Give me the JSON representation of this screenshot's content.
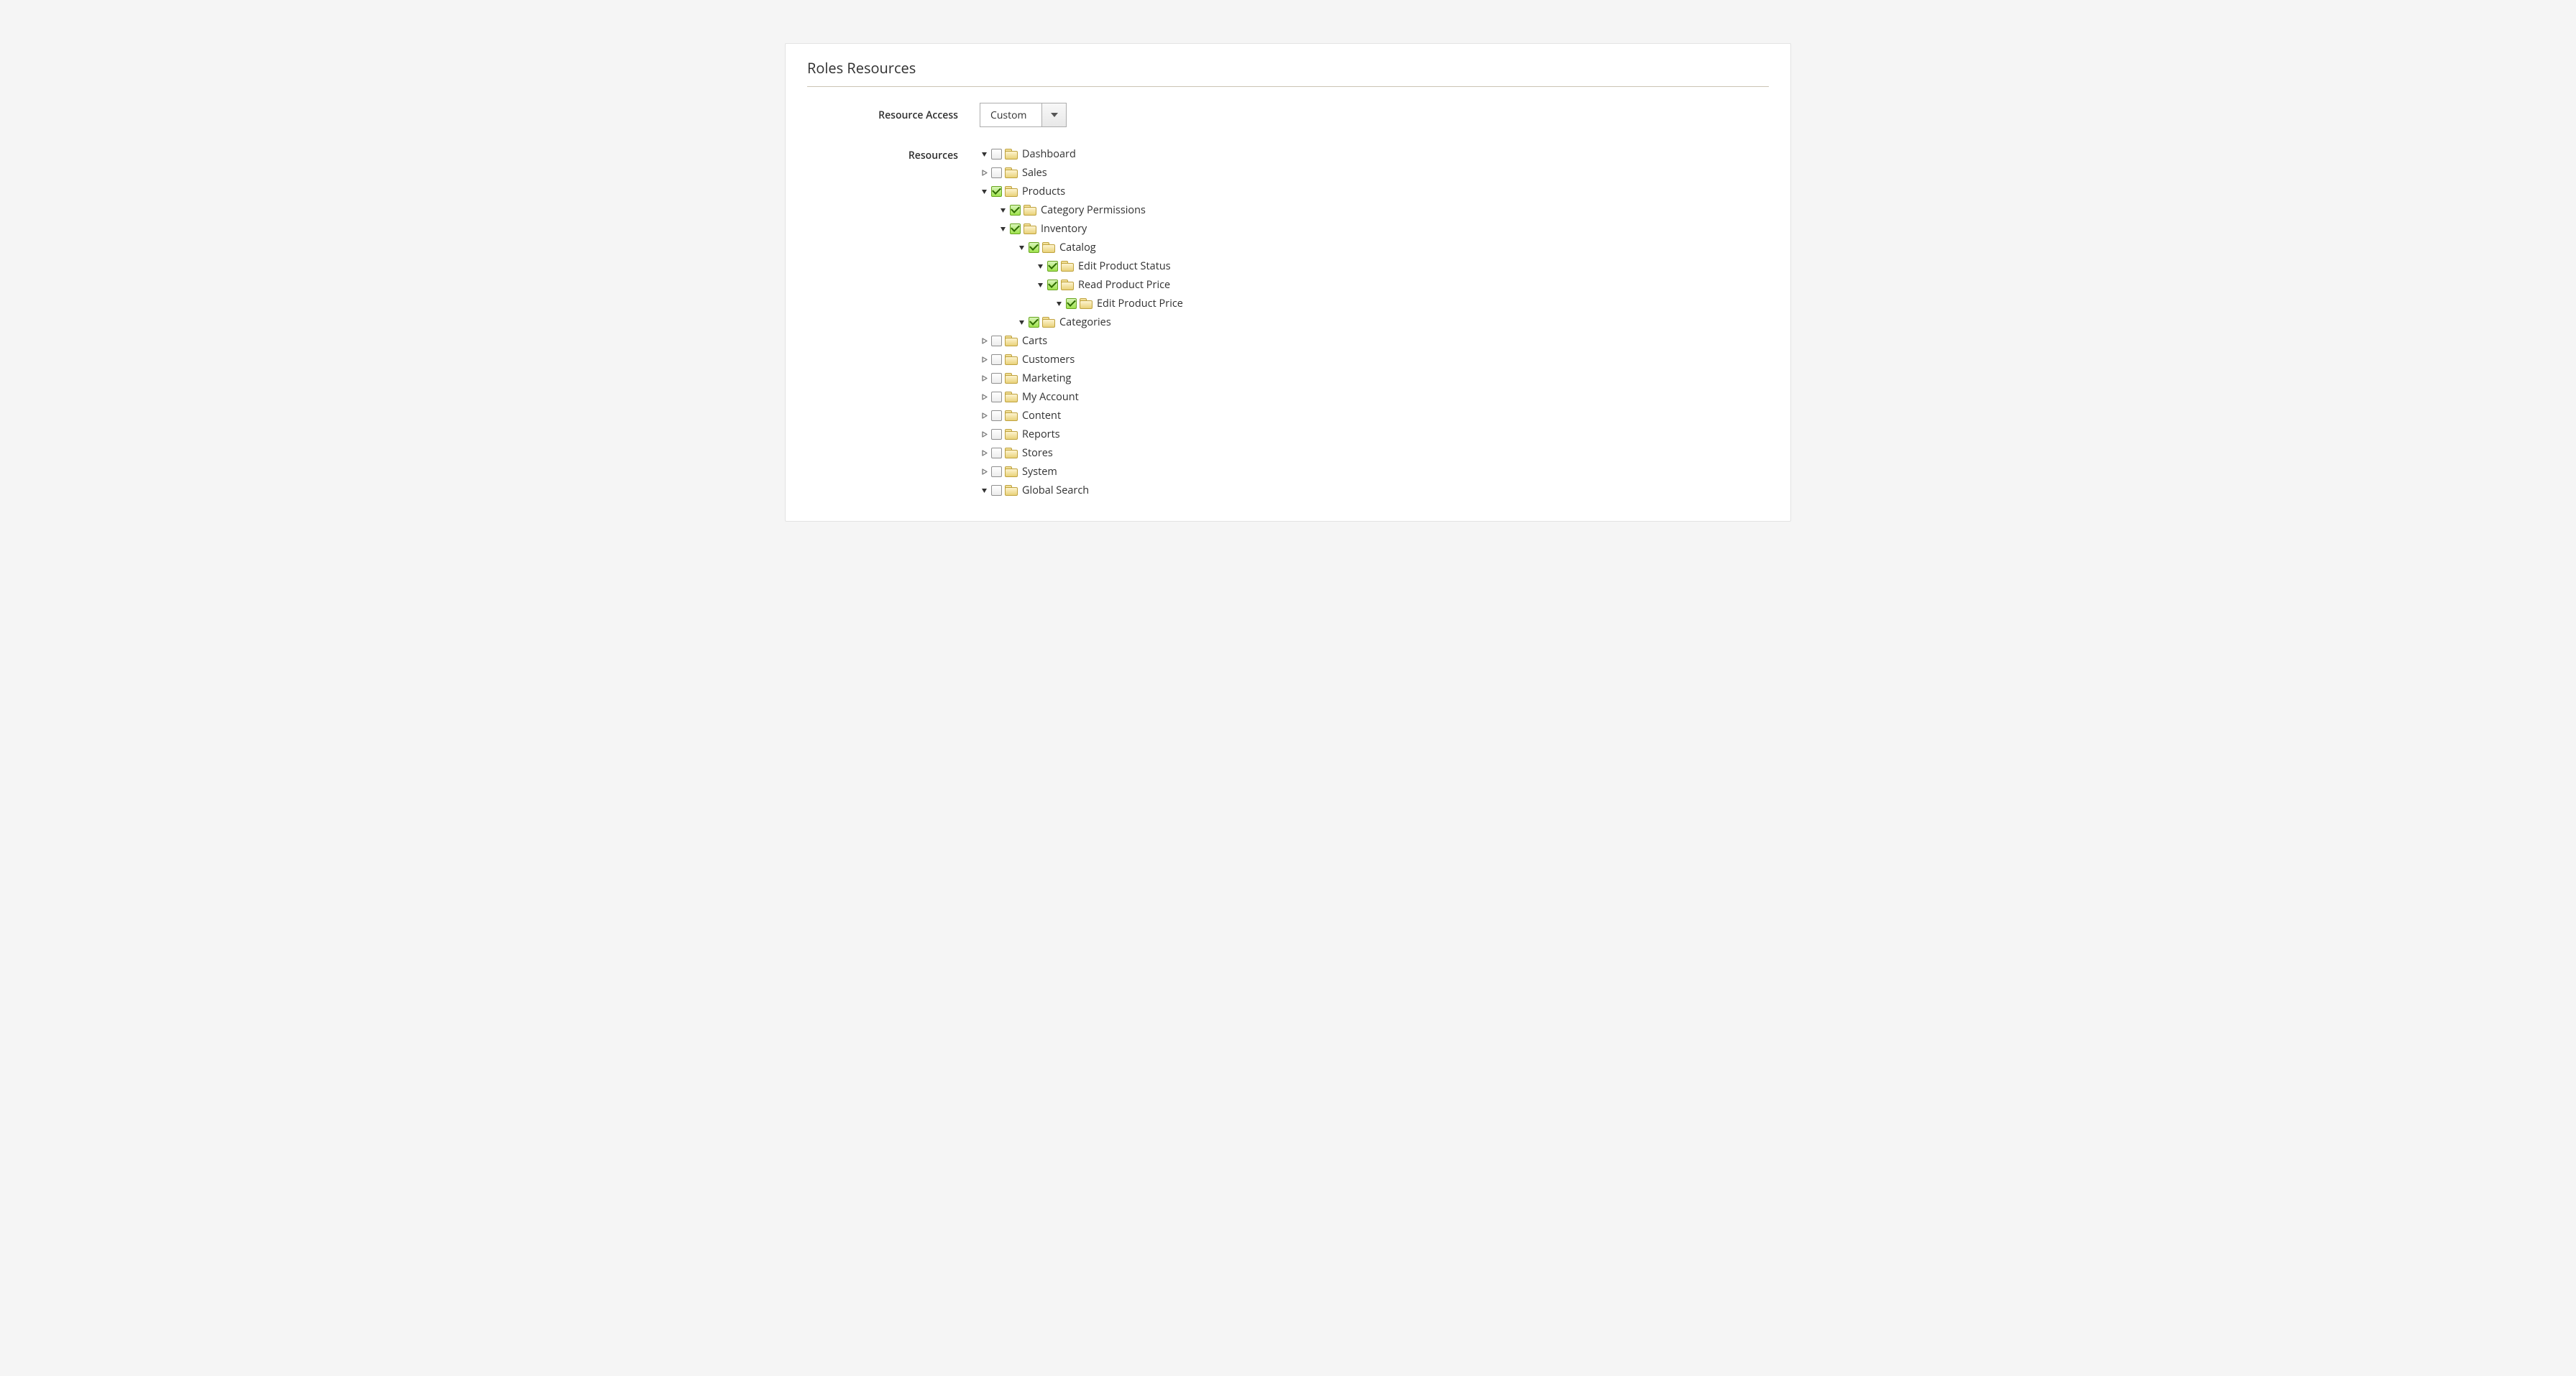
{
  "panel": {
    "title": "Roles Resources"
  },
  "labels": {
    "resource_access": "Resource Access",
    "resources": "Resources"
  },
  "select": {
    "value": "Custom"
  },
  "tree": [
    {
      "label": "Dashboard",
      "checked": false,
      "expanded": true,
      "hasChildren": false
    },
    {
      "label": "Sales",
      "checked": false,
      "expanded": false,
      "hasChildren": true
    },
    {
      "label": "Products",
      "checked": true,
      "expanded": true,
      "hasChildren": true,
      "children": [
        {
          "label": "Category Permissions",
          "checked": true,
          "expanded": true,
          "hasChildren": false
        },
        {
          "label": "Inventory",
          "checked": true,
          "expanded": true,
          "hasChildren": true,
          "children": [
            {
              "label": "Catalog",
              "checked": true,
              "expanded": true,
              "hasChildren": true,
              "children": [
                {
                  "label": "Edit Product Status",
                  "checked": true,
                  "expanded": true,
                  "hasChildren": false
                },
                {
                  "label": "Read Product Price",
                  "checked": true,
                  "expanded": true,
                  "hasChildren": true,
                  "children": [
                    {
                      "label": "Edit Product Price",
                      "checked": true,
                      "expanded": true,
                      "hasChildren": false
                    }
                  ]
                }
              ]
            },
            {
              "label": "Categories",
              "checked": true,
              "expanded": true,
              "hasChildren": false
            }
          ]
        }
      ]
    },
    {
      "label": "Carts",
      "checked": false,
      "expanded": false,
      "hasChildren": true
    },
    {
      "label": "Customers",
      "checked": false,
      "expanded": false,
      "hasChildren": true
    },
    {
      "label": "Marketing",
      "checked": false,
      "expanded": false,
      "hasChildren": true
    },
    {
      "label": "My Account",
      "checked": false,
      "expanded": false,
      "hasChildren": true
    },
    {
      "label": "Content",
      "checked": false,
      "expanded": false,
      "hasChildren": true
    },
    {
      "label": "Reports",
      "checked": false,
      "expanded": false,
      "hasChildren": true
    },
    {
      "label": "Stores",
      "checked": false,
      "expanded": false,
      "hasChildren": true
    },
    {
      "label": "System",
      "checked": false,
      "expanded": false,
      "hasChildren": true
    },
    {
      "label": "Global Search",
      "checked": false,
      "expanded": true,
      "hasChildren": false
    }
  ]
}
